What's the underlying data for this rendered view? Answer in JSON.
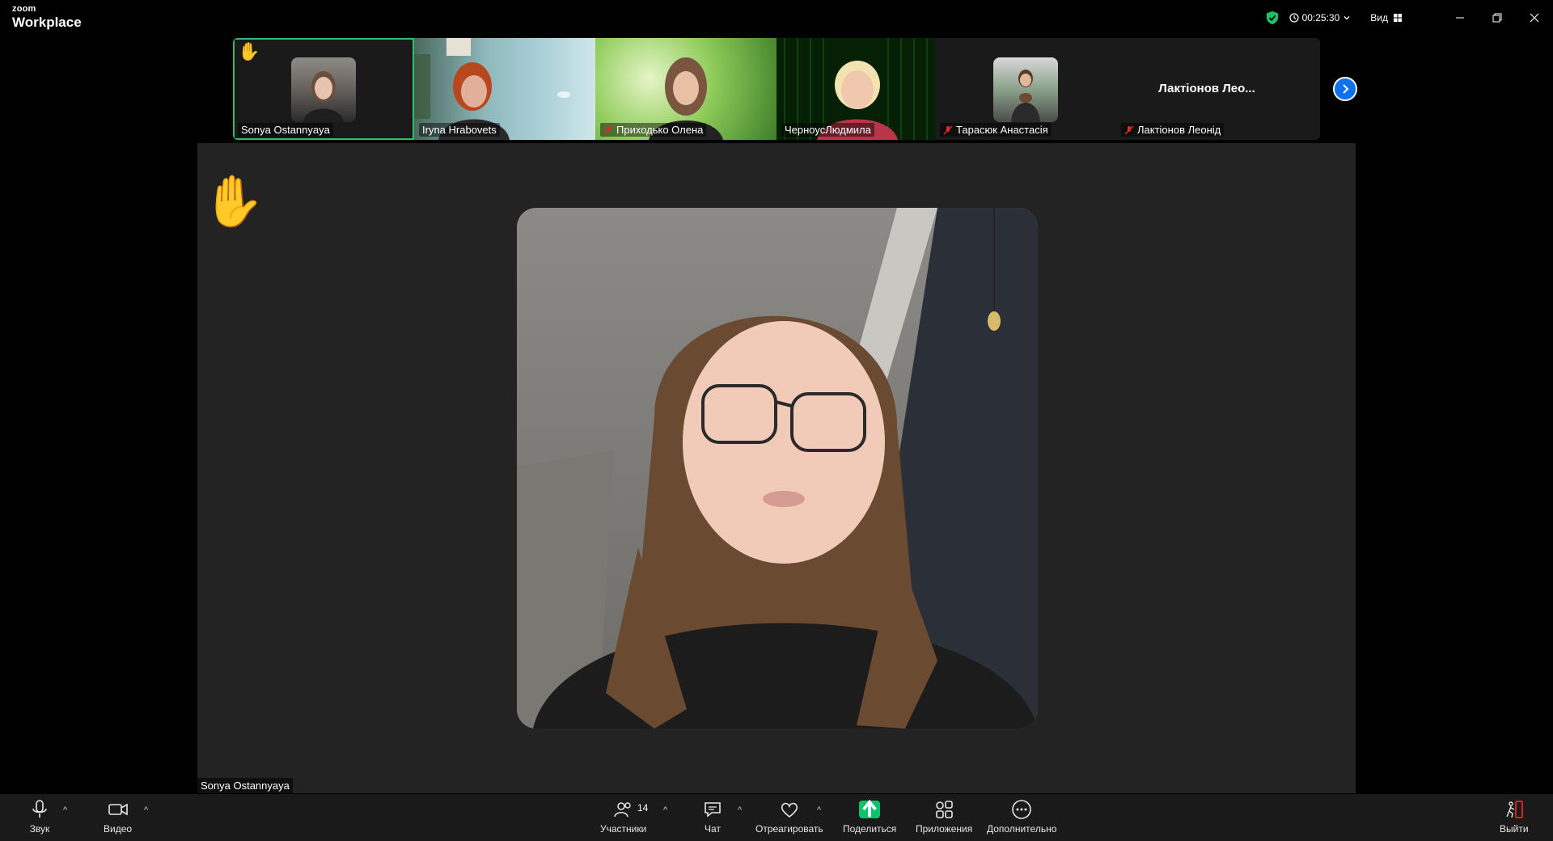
{
  "app": {
    "logo_top": "zoom",
    "logo_bottom": "Workplace",
    "timer": "00:25:30",
    "view_label": "Вид"
  },
  "filmstrip": [
    {
      "name": "Sonya Ostannyaya",
      "muted": false,
      "active": true,
      "hand_raised": true,
      "style": "avatar"
    },
    {
      "name": "Iryna Hrabovets",
      "muted": false,
      "active": false,
      "hand_raised": false,
      "style": "video"
    },
    {
      "name": "Приходько Олена",
      "muted": true,
      "active": false,
      "hand_raised": false,
      "style": "video"
    },
    {
      "name": "ЧерноусЛюдмила",
      "muted": false,
      "active": false,
      "hand_raised": false,
      "style": "video"
    },
    {
      "name": "Тарасюк Анастасія",
      "muted": true,
      "active": false,
      "hand_raised": false,
      "style": "avatar"
    },
    {
      "name": "Лактіонов Леонід",
      "muted": true,
      "active": false,
      "hand_raised": false,
      "style": "name",
      "display": "Лактіонов  Лео..."
    }
  ],
  "stage": {
    "speaker_name": "Sonya Ostannyaya"
  },
  "toolbar": {
    "audio": "Звук",
    "video": "Видео",
    "participants": "Участники",
    "participants_count": "14",
    "chat": "Чат",
    "react": "Отреагировать",
    "share": "Поделиться",
    "apps": "Приложения",
    "more": "Дополнительно",
    "leave": "Выйти"
  },
  "colors": {
    "accent": "#0e72ed",
    "active_border": "#27c26a",
    "share_green": "#0ac36b",
    "leave_red": "#e02828"
  }
}
